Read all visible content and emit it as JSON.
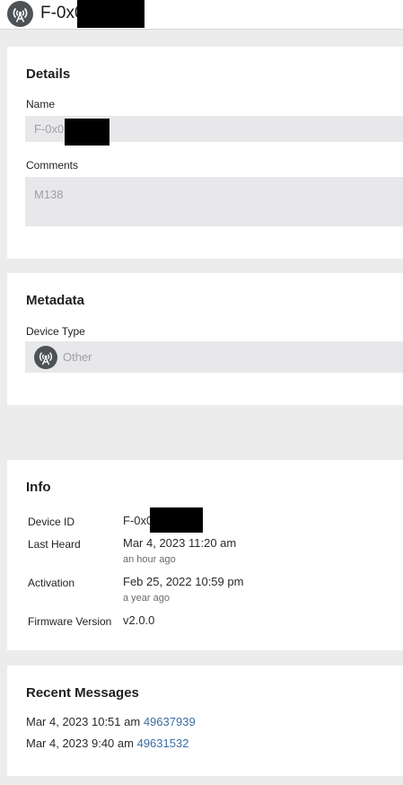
{
  "header": {
    "icon": "antenna-tower-icon",
    "title": "F-0x0"
  },
  "details": {
    "title": "Details",
    "name_label": "Name",
    "name_value": "F-0x0",
    "comments_label": "Comments",
    "comments_value": "M138"
  },
  "metadata": {
    "title": "Metadata",
    "device_type_label": "Device Type",
    "device_type_icon": "antenna-tower-icon",
    "device_type_value": "Other"
  },
  "info": {
    "title": "Info",
    "rows": [
      {
        "label": "Device ID",
        "value": "F-0x0",
        "sub": ""
      },
      {
        "label": "Last Heard",
        "value": "Mar 4, 2023 11:20 am",
        "sub": "an hour ago"
      },
      {
        "label": "Activation",
        "value": "Feb 25, 2022 10:59 pm",
        "sub": "a year ago"
      },
      {
        "label": "Firmware Version",
        "value": "v2.0.0",
        "sub": ""
      }
    ]
  },
  "recent_messages": {
    "title": "Recent Messages",
    "items": [
      {
        "time": "Mar 4, 2023 10:51 am",
        "id": "49637939"
      },
      {
        "time": "Mar 4, 2023 9:40 am",
        "id": "49631532"
      }
    ]
  },
  "colors": {
    "page_bg": "#ececec",
    "card_bg": "#ffffff",
    "field_bg": "#e8e8eb",
    "icon_bg": "#4d5257",
    "link": "#3a6ea5"
  }
}
